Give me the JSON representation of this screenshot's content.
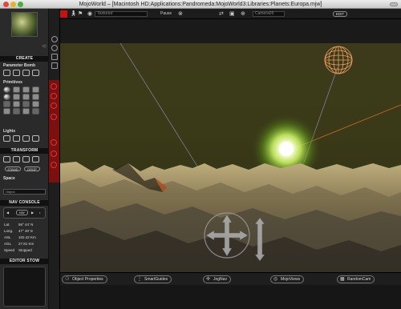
{
  "window": {
    "title": "MojoWorld – [Macintosh HD:Applications:Pandromeda:MojoWorld3:Libraries:Planets:Europa.mjw]"
  },
  "sidebar": {
    "thumb_hint": "?Ⓒ",
    "create": {
      "heading": "CREATE",
      "parameter_bomb": "Parameter Bomb",
      "primitives": "Primitives",
      "lights": "Lights"
    },
    "transform": {
      "heading": "TRANSFORM",
      "stand_label": "STAND",
      "drop_label": "DROP",
      "space_label": "Space",
      "space_value": "Object"
    },
    "nav_console": {
      "heading": "NAV CONSOLE",
      "left_arrow": "◀",
      "heading_value": "NW",
      "right_arrow": "▶",
      "step": "•",
      "rows": [
        {
          "key": "Lat.",
          "value": "56° 44' N"
        },
        {
          "key": "Long.",
          "value": "47° 40' E"
        },
        {
          "key": "ASL",
          "value": "102.42 Km"
        },
        {
          "key": "AGL",
          "value": "27.81 Km"
        },
        {
          "key": "Speed",
          "value": "Stopped"
        }
      ]
    },
    "editor_stow": {
      "heading": "EDITOR STOW"
    }
  },
  "toolbar": {
    "view_mode": "Textured",
    "pause_label": "Pause",
    "camera_field": "Camera05",
    "edit_label": "EDIT"
  },
  "bottombar": {
    "object_properties": "Object Properties",
    "smart_guides": "SmartGuides",
    "jog_nav": "JogNav",
    "mojo_views": "MojoViews",
    "random_cam": "RandomCam"
  },
  "colors": {
    "accent_red": "#c81010",
    "sun_glow": "#e6ff8a",
    "terrain_light": "#d8c896",
    "terrain_dark": "#4a4436"
  },
  "icons": {
    "toolbar": [
      "select-arrow-icon",
      "walk-icon",
      "run-icon",
      "eye-icon",
      "close-circle-icon",
      "undo-icon",
      "camera-icon",
      "add-camera-icon"
    ],
    "viewport": [
      "moon-wireframe-icon",
      "move-cross-gizmo",
      "vertical-slider-gizmo"
    ]
  }
}
